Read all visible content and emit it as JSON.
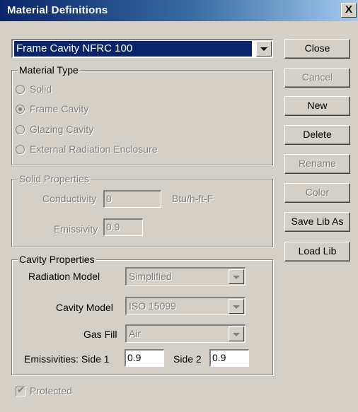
{
  "window": {
    "title": "Material Definitions",
    "close_glyph": "X"
  },
  "material_select": {
    "value": "Frame Cavity NFRC 100"
  },
  "material_type": {
    "legend": "Material Type",
    "options": [
      {
        "label": "Solid",
        "selected": false
      },
      {
        "label": "Frame Cavity",
        "selected": true
      },
      {
        "label": "Glazing Cavity",
        "selected": false
      },
      {
        "label": "External Radiation Enclosure",
        "selected": false
      }
    ]
  },
  "solid_properties": {
    "legend": "Solid Properties",
    "conductivity_label": "Conductivity",
    "conductivity_value": "0",
    "conductivity_unit": "Btu/h-ft-F",
    "emissivity_label": "Emissivity",
    "emissivity_value": "0.9"
  },
  "cavity_properties": {
    "legend": "Cavity Properties",
    "radiation_model_label": "Radiation Model",
    "radiation_model_value": "Simplified",
    "cavity_model_label": "Cavity Model",
    "cavity_model_value": "ISO 15099",
    "gas_fill_label": "Gas Fill",
    "gas_fill_value": "Air",
    "emissivities_label": "Emissivities: Side 1",
    "side1_value": "0.9",
    "side2_label": "Side 2",
    "side2_value": "0.9"
  },
  "protected": {
    "label": "Protected",
    "checked": true,
    "check_glyph": "✔"
  },
  "buttons": {
    "close": "Close",
    "cancel": "Cancel",
    "new": "New",
    "delete": "Delete",
    "rename": "Rename",
    "color": "Color",
    "save_lib_as": "Save Lib As",
    "load_lib": "Load Lib"
  },
  "colors": {
    "title_gradient_start": "#0a246a",
    "title_gradient_end": "#a6caf0",
    "face": "#d4d0c8",
    "selection": "#0a246a",
    "disabled_text": "#808080"
  }
}
